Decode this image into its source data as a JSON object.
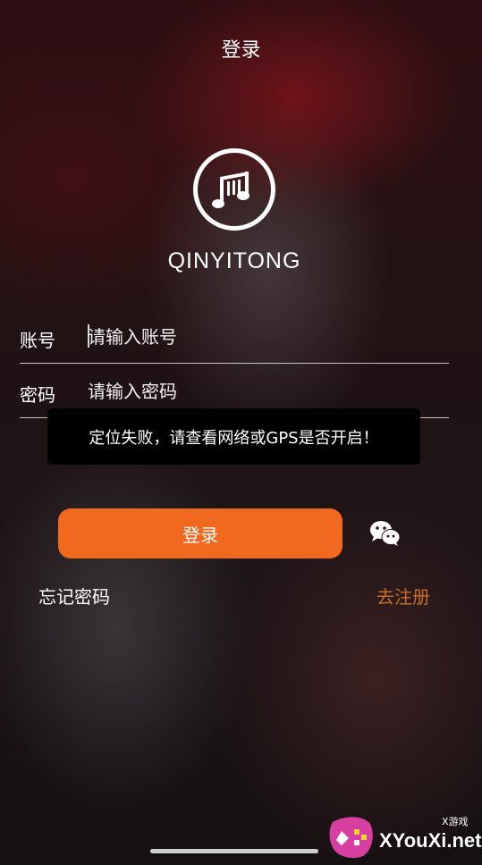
{
  "header": {
    "title": "登录"
  },
  "brand": {
    "name": "QINYITONG",
    "logo_icon": "music-note-icon"
  },
  "form": {
    "account": {
      "label": "账号",
      "placeholder": "请输入账号",
      "value": ""
    },
    "password": {
      "label": "密码",
      "placeholder": "请输入密码",
      "value": ""
    }
  },
  "toast": {
    "message": "定位失败，请查看网络或GPS是否开启！"
  },
  "actions": {
    "login_label": "登录",
    "wechat_icon": "wechat-icon",
    "forgot_label": "忘记密码",
    "register_label": "去注册"
  },
  "watermark": {
    "small": "X游戏",
    "site": "XYouXi.net"
  },
  "colors": {
    "accent": "#f0691f",
    "register": "#c96c28",
    "toast_bg": "#000000"
  }
}
